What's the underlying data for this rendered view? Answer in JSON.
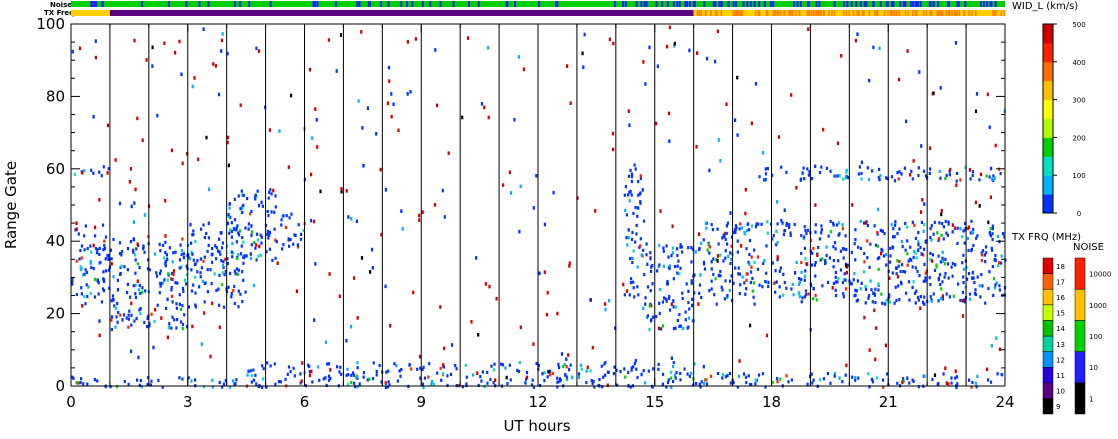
{
  "chart_data": {
    "type": "heatmap",
    "title": "",
    "xlabel": "UT hours",
    "ylabel": "Range Gate",
    "xlim": [
      0,
      24
    ],
    "ylim": [
      0,
      100
    ],
    "xticks": [
      "0",
      "3",
      "6",
      "9",
      "12",
      "15",
      "18",
      "21",
      "24"
    ],
    "yticks": [
      "0",
      "20",
      "40",
      "60",
      "80",
      "100"
    ],
    "grid": "vertical lines every 1 hour",
    "status_bars": {
      "noise_label": "Noise",
      "txfreq_label": "TX Freq"
    },
    "colorbars": {
      "width": {
        "label": "WID_L (km/s)",
        "ticks": [
          "0",
          "100",
          "200",
          "300",
          "400",
          "500"
        ],
        "range": [
          0,
          500
        ],
        "colors": [
          "#0033ff",
          "#00b0ff",
          "#00e0c0",
          "#00d000",
          "#b0ff00",
          "#ffff00",
          "#ffc000",
          "#ff7000",
          "#ff2000",
          "#d00000"
        ]
      },
      "txfreq": {
        "label": "TX FRQ (MHz)",
        "ticks": [
          "9",
          "10",
          "11",
          "12",
          "13",
          "14",
          "15",
          "16",
          "17",
          "18"
        ],
        "colors": [
          "#000000",
          "#5a0080",
          "#2800e0",
          "#0090ff",
          "#00d0a0",
          "#00c000",
          "#c0ff00",
          "#ffc000",
          "#ff6000",
          "#e00000"
        ]
      },
      "noise": {
        "label": "NOISE",
        "ticks": [
          "1",
          "10",
          "100",
          "1000",
          "10000"
        ],
        "colors": [
          "#000000",
          "#2020ff",
          "#00d000",
          "#ffc000",
          "#ff2000"
        ]
      }
    },
    "scatter_bands": [
      {
        "x0": 0.0,
        "x1": 1.0,
        "y0": 23,
        "y1": 45,
        "value": 80
      },
      {
        "x0": 1.0,
        "x1": 3.0,
        "y0": 16,
        "y1": 42,
        "value": 80
      },
      {
        "x0": 3.0,
        "x1": 4.5,
        "y0": 22,
        "y1": 45,
        "value": 90
      },
      {
        "x0": 4.0,
        "x1": 5.3,
        "y0": 35,
        "y1": 55,
        "value": 110
      },
      {
        "x0": 5.3,
        "x1": 6.0,
        "y0": 38,
        "y1": 48,
        "value": 120
      },
      {
        "x0": 14.2,
        "x1": 14.7,
        "y0": 25,
        "y1": 62,
        "value": 100
      },
      {
        "x0": 14.7,
        "x1": 16.0,
        "y0": 16,
        "y1": 40,
        "value": 80
      },
      {
        "x0": 16.1,
        "x1": 24.0,
        "y0": 23,
        "y1": 46,
        "value": 80
      },
      {
        "x0": 0.0,
        "x1": 1.0,
        "y0": 58,
        "y1": 61,
        "value": 60
      },
      {
        "x0": 17.5,
        "x1": 24.0,
        "y0": 57,
        "y1": 61,
        "value": 60
      },
      {
        "x0": 4.5,
        "x1": 16.0,
        "y0": 0,
        "y1": 7,
        "value": 70
      },
      {
        "x0": 0.0,
        "x1": 4.5,
        "y0": 0,
        "y1": 3,
        "value": 70
      },
      {
        "x0": 16.0,
        "x1": 24.0,
        "y0": 0,
        "y1": 4,
        "value": 70
      }
    ]
  }
}
